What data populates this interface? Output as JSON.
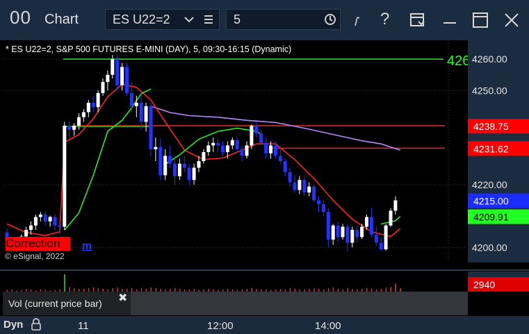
{
  "window": {
    "icon_text": "00",
    "title": "Chart",
    "symbol_value": "ES U22=2",
    "interval_value": "5",
    "help_glyph": "?",
    "icons": [
      "chevron-down-icon",
      "list-icon",
      "clock-icon",
      "draw-tool-icon",
      "help-icon",
      "dropdown-panel-icon",
      "maximize-icon",
      "close-icon"
    ]
  },
  "chart_info": "* ES U22=2, S&P 500 FUTURES E-MINI (DAY), 5, 09:30-16:15 (Dynamic)",
  "overlays": {
    "level_tag": "4260.00",
    "correction_label": "Correction",
    "m_label": "m",
    "copyright": "© eSignal, 2022"
  },
  "volume_panel": {
    "label": "Vol (current price bar)",
    "close_glyph": "✖",
    "value_badge": "2940"
  },
  "bottom": {
    "dyn_label": "Dyn",
    "time_labels": [
      "11",
      "12:00",
      "14:00"
    ]
  },
  "colors": {
    "background": "#000000",
    "up_candle": "#ffffff",
    "down_candle": "#2233ff",
    "red_line": "#ff2020",
    "green_line": "#22ee22",
    "purple_line": "#b388ff"
  },
  "chart_data": {
    "type": "candlestick",
    "ylim": [
      4193,
      4266
    ],
    "y_ticks": [
      "4260.00",
      "4250.00",
      "4220.00",
      "4200.00"
    ],
    "y_tick_values": [
      4260,
      4250,
      4220,
      4200
    ],
    "price_badges": [
      {
        "label": "4238.75",
        "value": 4238.75,
        "bg": "#ff0000",
        "fg": "#ffffff"
      },
      {
        "label": "4231.62",
        "value": 4231.62,
        "bg": "#ff0000",
        "fg": "#ffffff"
      },
      {
        "label": "4215.00",
        "value": 4215.0,
        "bg": "#1a2cff",
        "fg": "#ffffff"
      },
      {
        "label": "4209.91",
        "value": 4209.91,
        "bg": "#22ff22",
        "fg": "#000000"
      }
    ],
    "candles": [
      [
        4204.8,
        4206.0,
        4201.5,
        4202.0
      ],
      [
        4202.0,
        4203.2,
        4199.4,
        4200.3
      ],
      [
        4200.3,
        4203.2,
        4198.8,
        4202.0
      ],
      [
        4202.0,
        4204.1,
        4199.4,
        4203.5
      ],
      [
        4203.5,
        4206.6,
        4202.7,
        4205.6
      ],
      [
        4205.6,
        4208.3,
        4204.1,
        4207.0
      ],
      [
        4207.0,
        4210.5,
        4205.6,
        4209.7
      ],
      [
        4209.7,
        4211.3,
        4208.3,
        4210.5
      ],
      [
        4210.5,
        4211.3,
        4207.0,
        4208.3
      ],
      [
        4208.3,
        4210.1,
        4206.6,
        4209.7
      ],
      [
        4209.7,
        4210.5,
        4205.6,
        4207.0
      ],
      [
        4207.0,
        4208.3,
        4204.1,
        4206.6
      ],
      [
        4206.6,
        4240.0,
        4205.6,
        4238.8
      ],
      [
        4238.8,
        4240.0,
        4234.7,
        4237.5
      ],
      [
        4237.5,
        4239.6,
        4235.6,
        4238.8
      ],
      [
        4238.8,
        4242.8,
        4237.5,
        4241.5
      ],
      [
        4241.5,
        4244.1,
        4240.0,
        4243.1
      ],
      [
        4243.1,
        4247.0,
        4241.5,
        4246.1
      ],
      [
        4246.1,
        4248.3,
        4243.1,
        4244.7
      ],
      [
        4244.7,
        4250.0,
        4243.1,
        4249.2
      ],
      [
        4249.2,
        4253.8,
        4248.3,
        4252.7
      ],
      [
        4252.7,
        4256.3,
        4250.0,
        4255.0
      ],
      [
        4255.0,
        4261.3,
        4253.8,
        4260.0
      ],
      [
        4260.0,
        4261.3,
        4250.0,
        4251.7
      ],
      [
        4251.7,
        4258.8,
        4250.0,
        4257.5
      ],
      [
        4257.5,
        4258.8,
        4248.3,
        4249.2
      ],
      [
        4249.2,
        4252.7,
        4243.1,
        4245.0
      ],
      [
        4245.0,
        4248.3,
        4241.5,
        4246.1
      ],
      [
        4246.1,
        4250.0,
        4237.5,
        4240.0
      ],
      [
        4240.0,
        4246.1,
        4236.9,
        4245.0
      ],
      [
        4245.0,
        4246.1,
        4229.0,
        4231.3
      ],
      [
        4231.3,
        4235.0,
        4227.5,
        4232.0
      ],
      [
        4232.0,
        4234.7,
        4221.5,
        4223.0
      ],
      [
        4223.0,
        4231.3,
        4221.5,
        4229.2
      ],
      [
        4229.2,
        4232.5,
        4225.4,
        4226.7
      ],
      [
        4226.7,
        4229.2,
        4220.0,
        4222.7
      ],
      [
        4222.7,
        4228.3,
        4221.5,
        4226.7
      ],
      [
        4226.7,
        4229.2,
        4224.0,
        4225.4
      ],
      [
        4225.4,
        4226.7,
        4220.0,
        4221.5
      ],
      [
        4221.5,
        4226.7,
        4220.0,
        4225.4
      ],
      [
        4225.4,
        4229.2,
        4224.0,
        4227.5
      ],
      [
        4227.5,
        4231.3,
        4226.7,
        4230.4
      ],
      [
        4230.4,
        4233.8,
        4229.2,
        4232.5
      ],
      [
        4232.5,
        4235.0,
        4230.4,
        4233.3
      ],
      [
        4233.3,
        4234.7,
        4230.4,
        4232.5
      ],
      [
        4232.5,
        4233.8,
        4229.2,
        4230.4
      ],
      [
        4230.4,
        4233.8,
        4228.3,
        4232.5
      ],
      [
        4232.5,
        4235.0,
        4231.3,
        4234.2
      ],
      [
        4234.2,
        4235.0,
        4230.4,
        4231.3
      ],
      [
        4231.3,
        4232.5,
        4227.5,
        4229.2
      ],
      [
        4229.2,
        4233.8,
        4228.3,
        4232.5
      ],
      [
        4232.5,
        4239.2,
        4231.3,
        4238.8
      ],
      [
        4238.8,
        4240.0,
        4235.0,
        4236.3
      ],
      [
        4236.3,
        4237.5,
        4232.5,
        4233.3
      ],
      [
        4233.3,
        4235.0,
        4228.3,
        4230.0
      ],
      [
        4230.0,
        4233.8,
        4228.3,
        4232.5
      ],
      [
        4232.5,
        4233.8,
        4228.3,
        4229.2
      ],
      [
        4229.2,
        4232.5,
        4226.7,
        4227.5
      ],
      [
        4227.5,
        4228.3,
        4222.7,
        4224.0
      ],
      [
        4224.0,
        4225.4,
        4219.4,
        4220.7
      ],
      [
        4220.7,
        4223.0,
        4217.5,
        4218.3
      ],
      [
        4218.3,
        4222.7,
        4217.0,
        4221.5
      ],
      [
        4221.5,
        4222.7,
        4216.3,
        4217.5
      ],
      [
        4217.5,
        4220.7,
        4216.3,
        4219.4
      ],
      [
        4219.4,
        4220.0,
        4214.5,
        4215.0
      ],
      [
        4215.0,
        4216.3,
        4211.3,
        4213.8
      ],
      [
        4213.8,
        4215.0,
        4210.0,
        4211.3
      ],
      [
        4211.3,
        4212.5,
        4200.0,
        4202.5
      ],
      [
        4202.5,
        4207.5,
        4200.8,
        4207.0
      ],
      [
        4207.0,
        4208.3,
        4202.0,
        4203.3
      ],
      [
        4203.3,
        4207.5,
        4202.5,
        4206.6
      ],
      [
        4206.6,
        4207.5,
        4198.8,
        4201.5
      ],
      [
        4201.5,
        4206.6,
        4200.0,
        4205.6
      ],
      [
        4205.6,
        4207.0,
        4201.7,
        4203.3
      ],
      [
        4203.3,
        4207.5,
        4202.7,
        4206.6
      ],
      [
        4206.6,
        4210.5,
        4205.6,
        4209.7
      ],
      [
        4209.7,
        4212.5,
        4203.3,
        4204.1
      ],
      [
        4204.1,
        4206.6,
        4200.5,
        4201.5
      ],
      [
        4201.5,
        4203.3,
        4198.8,
        4199.4
      ],
      [
        4199.4,
        4207.5,
        4199.0,
        4207.0
      ],
      [
        4207.0,
        4212.5,
        4206.6,
        4211.7
      ],
      [
        4211.7,
        4216.3,
        4210.5,
        4215.0
      ]
    ],
    "volumes": [
      3,
      4,
      2,
      3,
      5,
      3,
      2,
      4,
      3,
      2,
      3,
      4,
      30,
      8,
      6,
      5,
      5,
      6,
      7,
      6,
      5,
      4,
      6,
      7,
      5,
      5,
      6,
      4,
      6,
      5,
      7,
      6,
      5,
      4,
      5,
      6,
      5,
      4,
      4,
      5,
      3,
      4,
      5,
      4,
      3,
      4,
      5,
      4,
      3,
      4,
      5,
      6,
      5,
      4,
      4,
      3,
      4,
      5,
      4,
      6,
      5,
      4,
      4,
      5,
      6,
      5,
      4,
      6,
      7,
      5,
      4,
      6,
      5,
      4,
      5,
      6,
      5,
      4,
      5,
      7,
      8,
      14,
      6
    ],
    "red_line": [
      [
        0,
        4207.5
      ],
      [
        4,
        4204.8
      ],
      [
        8,
        4203.8
      ],
      [
        11,
        4205.0
      ],
      [
        12,
        4233.5
      ],
      [
        15,
        4236.0
      ],
      [
        18,
        4241.0
      ],
      [
        21,
        4248.0
      ],
      [
        24,
        4252.0
      ],
      [
        27,
        4251.0
      ],
      [
        30,
        4247.0
      ],
      [
        33,
        4240.0
      ],
      [
        37,
        4231.0
      ],
      [
        41,
        4228.0
      ],
      [
        45,
        4228.5
      ],
      [
        49,
        4231.0
      ],
      [
        52,
        4233.0
      ],
      [
        56,
        4233.0
      ],
      [
        60,
        4228.0
      ],
      [
        64,
        4222.0
      ],
      [
        68,
        4215.0
      ],
      [
        72,
        4209.0
      ],
      [
        76,
        4205.0
      ],
      [
        80,
        4203.5
      ],
      [
        82,
        4206.0
      ]
    ],
    "green_line": [
      [
        12,
        4205.5
      ],
      [
        15,
        4211.0
      ],
      [
        18,
        4223.0
      ],
      [
        21,
        4237.0
      ],
      [
        24,
        4240.5
      ],
      [
        26,
        4244.5
      ],
      [
        28,
        4249.0
      ],
      [
        30,
        4250.5
      ]
    ],
    "green_line_right": [
      [
        33,
        4226.5
      ],
      [
        36,
        4229.5
      ],
      [
        40,
        4234.5
      ],
      [
        44,
        4237.0
      ],
      [
        48,
        4238.0
      ],
      [
        52,
        4237.0
      ],
      [
        53,
        4236.0
      ]
    ],
    "green_line_tail": [
      [
        78,
        4207.5
      ],
      [
        81,
        4208.5
      ],
      [
        82,
        4209.9
      ]
    ],
    "purple_line": [
      [
        30,
        4245.0
      ],
      [
        34,
        4243.0
      ],
      [
        38,
        4242.0
      ],
      [
        44,
        4241.5
      ],
      [
        50,
        4240.5
      ],
      [
        56,
        4239.8
      ],
      [
        62,
        4238.0
      ],
      [
        68,
        4236.0
      ],
      [
        74,
        4234.0
      ],
      [
        78,
        4233.0
      ],
      [
        82,
        4231.0
      ]
    ],
    "red_step_levels": [
      {
        "from": 12,
        "to": 82,
        "value": 4238.75
      },
      {
        "from": 52,
        "to": 82,
        "value": 4231.62
      }
    ],
    "green_hline": {
      "from": 12,
      "to": 82,
      "value": 4260.0
    },
    "green_hline_mid": {
      "from": 12,
      "to": 30,
      "value": 4238.8
    },
    "xlabels_index": [
      {
        "label": "11",
        "index": 12
      },
      {
        "label": "12:00",
        "index": 40
      },
      {
        "label": "14:00",
        "index": 64
      }
    ]
  }
}
